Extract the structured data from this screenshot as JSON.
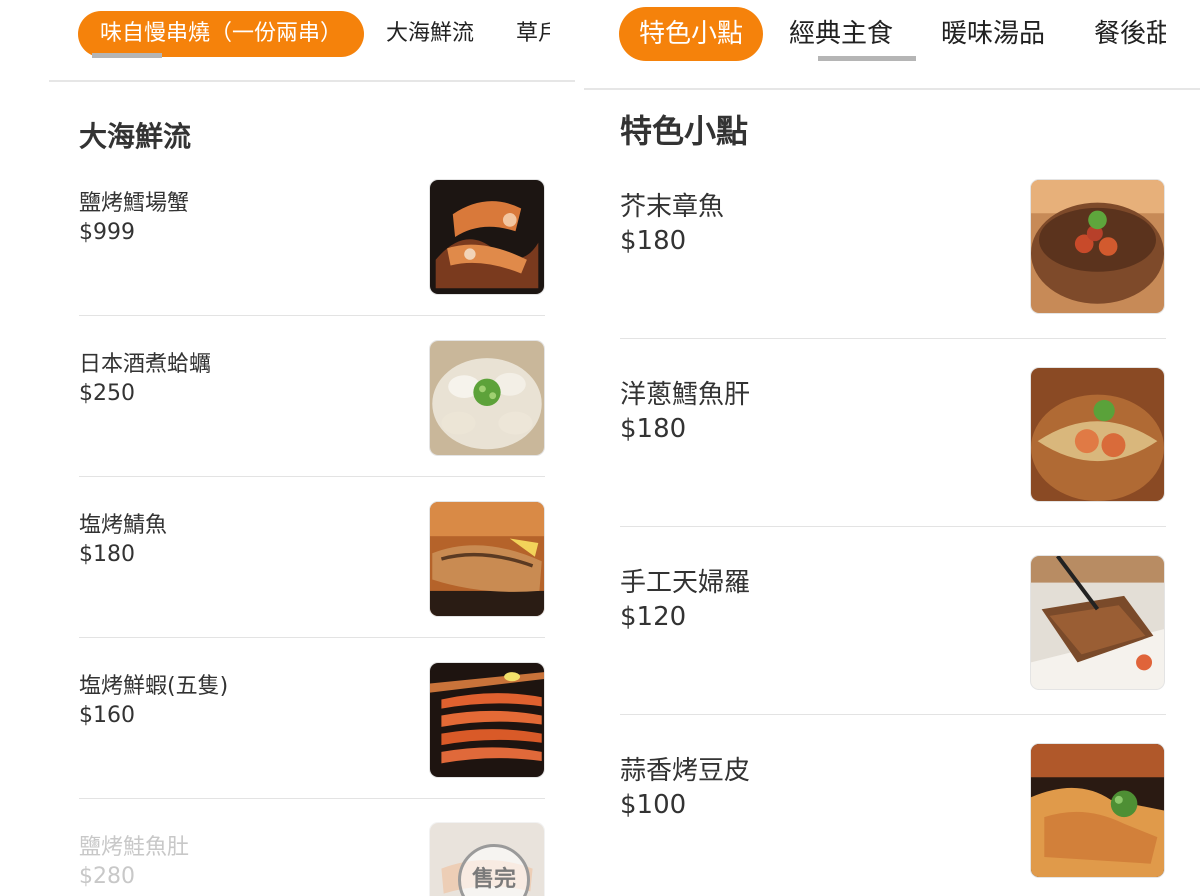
{
  "left": {
    "tabs": [
      {
        "label": "味自慢串燒（一份兩串）",
        "active": true
      },
      {
        "label": "大海鮮流",
        "active": false
      },
      {
        "label": "草戶",
        "active": false
      }
    ],
    "section_title": "大海鮮流",
    "items": [
      {
        "name": "鹽烤鱈場蟹",
        "price": "$999",
        "image": "crab-image"
      },
      {
        "name": "日本酒煮蛤蠣",
        "price": "$250",
        "image": "clam-image"
      },
      {
        "name": "塩烤鯖魚",
        "price": "$180",
        "image": "mackerel-image"
      },
      {
        "name": "塩烤鮮蝦(五隻)",
        "price": "$160",
        "image": "shrimp-image"
      },
      {
        "name": "鹽烤鮭魚肚",
        "price": "$280",
        "image": "salmon-belly-image",
        "sold_out": true,
        "stamp": "售完"
      }
    ]
  },
  "right": {
    "tabs": [
      {
        "label": "特色小點",
        "active": true
      },
      {
        "label": "經典主食",
        "active": false
      },
      {
        "label": "暖味湯品",
        "active": false
      },
      {
        "label": "餐後甜",
        "active": false
      }
    ],
    "section_title": "特色小點",
    "items": [
      {
        "name": "芥末章魚",
        "price": "$180",
        "image": "octopus-image"
      },
      {
        "name": "洋蔥鱈魚肝",
        "price": "$180",
        "image": "cod-liver-image"
      },
      {
        "name": "手工天婦羅",
        "price": "$120",
        "image": "tempura-image"
      },
      {
        "name": "蒜香烤豆皮",
        "price": "$100",
        "image": "tofu-skin-image"
      }
    ]
  },
  "colors": {
    "accent": "#f5820b",
    "text": "#333333",
    "muted": "#c8c8c8",
    "rule": "#e3e3e3"
  }
}
